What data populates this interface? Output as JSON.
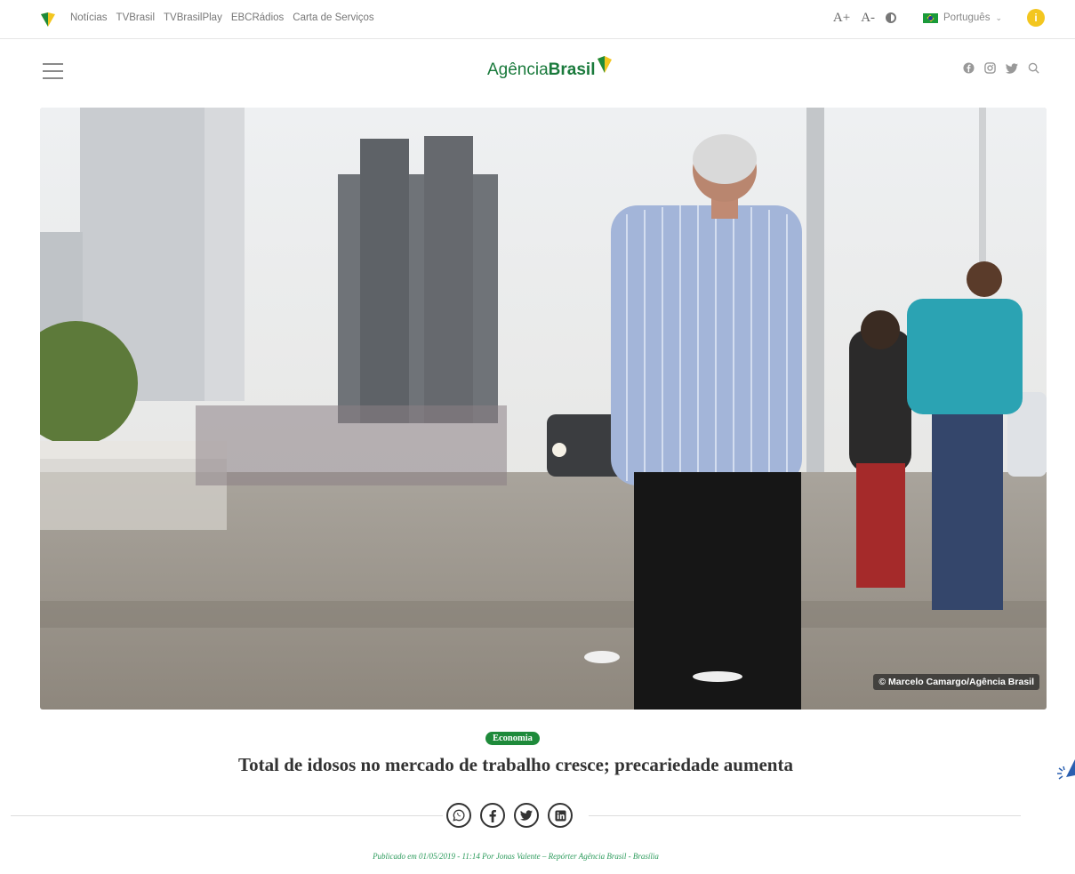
{
  "topbar": {
    "nav": [
      "Notícias",
      "TVBrasil",
      "TVBrasilPlay",
      "EBCRádios",
      "Carta de Serviços"
    ],
    "font_increase": "A+",
    "font_decrease": "A-",
    "language": "Português"
  },
  "header": {
    "logo_regular": "Agência",
    "logo_bold": "Brasil",
    "social_icons": [
      "facebook-icon",
      "instagram-icon",
      "twitter-icon",
      "search-icon"
    ]
  },
  "hero": {
    "credit": "© Marcelo Camargo/Agência Brasil"
  },
  "article": {
    "category": "Economia",
    "headline": "Total de idosos no mercado de trabalho cresce; precariedade aumenta",
    "published": "Publicado em 01/05/2019 - 11:14 Por Jonas Valente – Repórter Agência Brasil - Brasília",
    "share": [
      "whatsapp-icon",
      "facebook-icon",
      "twitter-icon",
      "linkedin-icon"
    ]
  },
  "colors": {
    "brand_green": "#1e8a3a",
    "brand_yellow": "#f3c61f",
    "link_green": "#2a9a5a"
  }
}
